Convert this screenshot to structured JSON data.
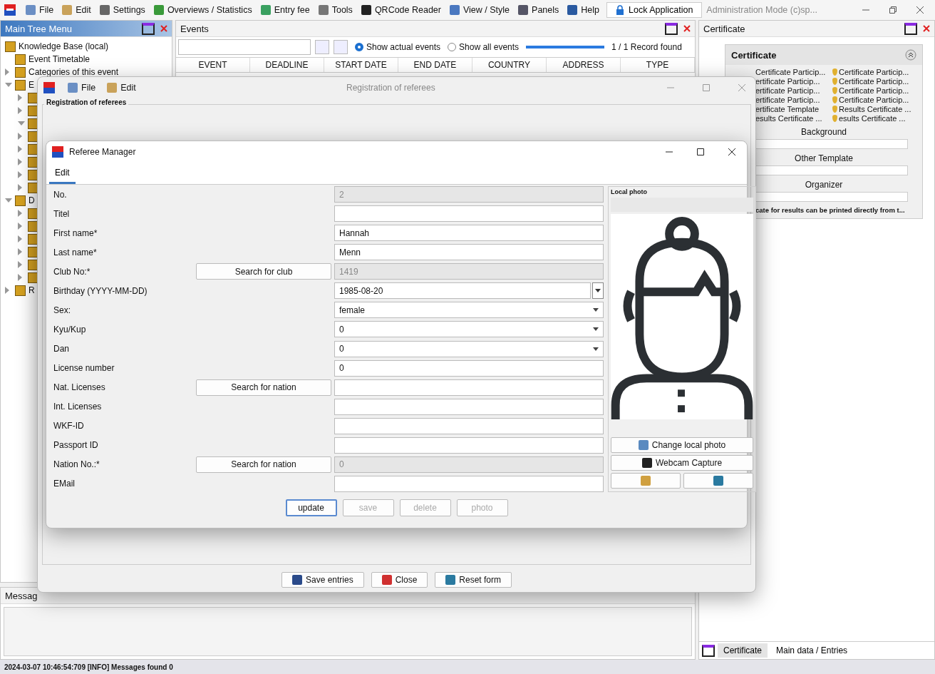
{
  "menu": [
    "File",
    "Edit",
    "Settings",
    "Overviews / Statistics",
    "Entry fee",
    "Tools",
    "QRCode Reader",
    "View / Style",
    "Panels",
    "Help"
  ],
  "lock_button": "Lock Application",
  "mode_text": "Administration Mode (c)sp...",
  "tree_panel": {
    "title": "Main Tree Menu",
    "items": [
      {
        "label": "Knowledge Base (local)",
        "children": [
          {
            "label": "Event Timetable"
          },
          {
            "label": "Categories of this event",
            "expanded": false
          },
          {
            "label": "E",
            "expanded": true,
            "children": [
              {
                "expanded": false
              },
              {
                "expanded": false
              },
              {
                "expanded": true
              },
              {
                "expanded": false
              },
              {
                "expanded": false
              },
              {
                "expanded": false
              },
              {
                "expanded": false
              },
              {
                "expanded": false
              }
            ]
          },
          {
            "label": "D",
            "expanded": true,
            "children": [
              {
                "expanded": false
              },
              {
                "expanded": false
              },
              {
                "expanded": false
              },
              {
                "expanded": false
              },
              {
                "expanded": false
              },
              {
                "expanded": false
              }
            ]
          },
          {
            "label": "R",
            "expanded": false
          }
        ]
      }
    ]
  },
  "events_panel": {
    "title": "Events",
    "filters": [
      {
        "label": "Show actual events",
        "selected": true
      },
      {
        "label": "Show all events",
        "selected": false
      }
    ],
    "progress": {
      "level": 1
    },
    "record_count": "1 / 1 Record found",
    "columns": [
      "EVENT",
      "DEADLINE",
      "START DATE",
      "END DATE",
      "COUNTRY",
      "ADDRESS",
      "TYPE"
    ]
  },
  "messages_panel": {
    "title": "Messag"
  },
  "certificate_panel": {
    "title": "Certificate",
    "section": "Certificate",
    "templates": [
      "Certificate Particip...",
      "Certificate Particip...",
      "ertificate Particip...",
      "Certificate Particip...",
      "ertificate Particip...",
      "Certificate Particip...",
      "ertificate Particip...",
      "Certificate Particip...",
      "ertificate Template",
      "Results Certificate ...",
      "esults Certificate ...",
      "esults Certificate ..."
    ],
    "fields": [
      {
        "label": "Background"
      },
      {
        "label": "Other Template"
      },
      {
        "label": "Organizer"
      }
    ],
    "note": "cate for results can be printed directly from t...",
    "tabs": [
      {
        "label": "Certificate",
        "selected": true
      },
      {
        "label": "Main data / Entries",
        "selected": false
      }
    ]
  },
  "registration_window": {
    "title": "Registration of referees",
    "menu": [
      "File",
      "Edit"
    ],
    "group_title": "Registration of referees",
    "buttons": [
      "Save entries",
      "Close",
      "Reset form"
    ]
  },
  "referee_window": {
    "title": "Referee Manager",
    "tabs": [
      {
        "label": "Edit",
        "selected": true
      }
    ],
    "rows": [
      {
        "kind": "text",
        "label": "No.",
        "value": "2",
        "disabled": true
      },
      {
        "kind": "text",
        "label": "Titel",
        "disabled": false
      },
      {
        "kind": "text",
        "label": "First name*",
        "value": "Hannah",
        "disabled": false
      },
      {
        "kind": "text",
        "label": "Last name*",
        "value": "Menn",
        "disabled": false
      },
      {
        "kind": "text",
        "label": "Club No:*",
        "button": "Search for club",
        "value": "1419",
        "disabled": true
      },
      {
        "kind": "date",
        "label": "Birthday (YYYY-MM-DD)",
        "value": "1985-08-20",
        "disabled": false
      },
      {
        "kind": "select",
        "label": "Sex:",
        "value": "female",
        "disabled": false
      },
      {
        "kind": "select",
        "label": "Kyu/Kup",
        "value": "0",
        "disabled": false
      },
      {
        "kind": "select",
        "label": "Dan",
        "value": "0",
        "disabled": false
      },
      {
        "kind": "text",
        "label": "License number",
        "value": "0",
        "disabled": false
      },
      {
        "kind": "text",
        "label": "Nat. Licenses",
        "button": "Search for nation",
        "disabled": false
      },
      {
        "kind": "text",
        "label": "Int. Licenses",
        "disabled": false
      },
      {
        "kind": "text",
        "label": "WKF-ID",
        "disabled": false
      },
      {
        "kind": "text",
        "label": "Passport ID",
        "disabled": false
      },
      {
        "kind": "text",
        "label": "Nation No.:*",
        "button": "Search for nation",
        "value": "0",
        "disabled": true
      },
      {
        "kind": "text",
        "label": "EMail",
        "disabled": false
      }
    ],
    "photo_title": "Local photo",
    "photo_buttons": [
      "Change local photo",
      "Webcam Capture"
    ],
    "actions": [
      {
        "label": "update",
        "disabled": false
      },
      {
        "label": "save",
        "disabled": true
      },
      {
        "label": "delete",
        "disabled": true
      },
      {
        "label": "photo",
        "disabled": true
      }
    ]
  },
  "status_bar": "2024-03-07 10:46:54:709 [INFO] Messages found 0"
}
